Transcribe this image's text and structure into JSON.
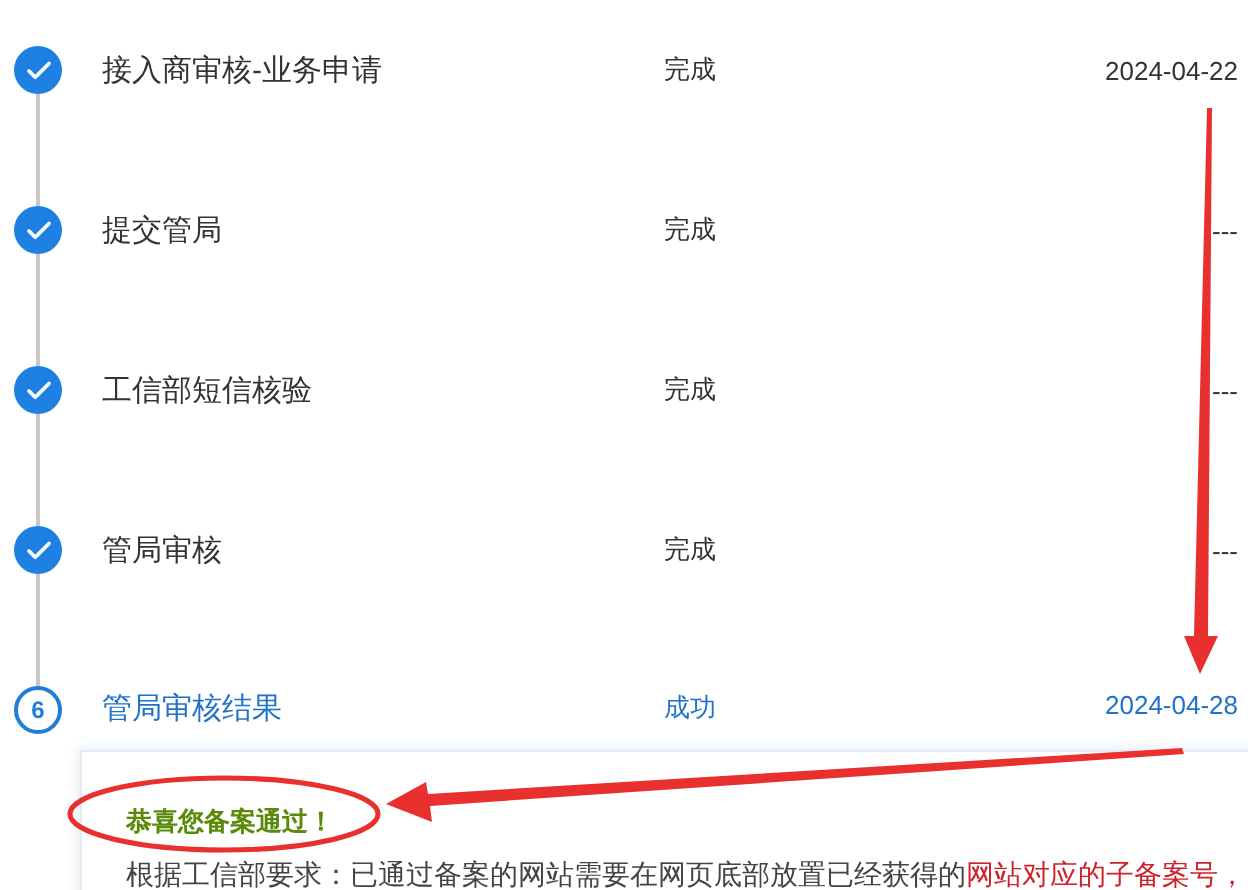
{
  "steps": [
    {
      "title": "接入商审核-业务申请",
      "status": "完成",
      "date": "2024-04-22",
      "kind": "done"
    },
    {
      "title": "提交管局",
      "status": "完成",
      "date": "---",
      "kind": "done"
    },
    {
      "title": "工信部短信核验",
      "status": "完成",
      "date": "---",
      "kind": "done"
    },
    {
      "title": "管局审核",
      "status": "完成",
      "date": "---",
      "kind": "done"
    },
    {
      "title": "管局审核结果",
      "status": "成功",
      "date": "2024-04-28",
      "kind": "current",
      "number": "6"
    }
  ],
  "result_panel": {
    "heading": "恭喜您备案通过！",
    "paragraph": [
      {
        "text": "根据工信部要求：已通过备案的网站需要在网页底部放置已经获得的",
        "highlight": false
      },
      {
        "text": "网站对应的子备案号，",
        "highlight": true
      }
    ]
  }
}
